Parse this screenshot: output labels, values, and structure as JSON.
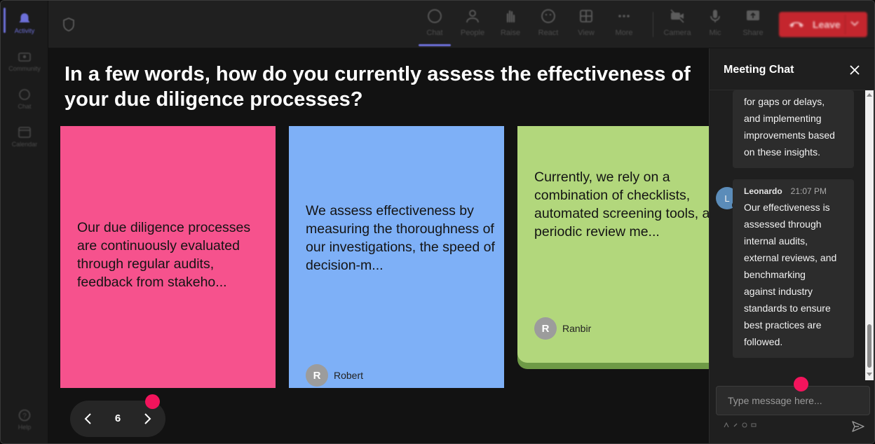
{
  "rail": {
    "items": [
      {
        "label": "Activity",
        "icon": "bell-icon"
      },
      {
        "label": "Community",
        "icon": "community-icon"
      },
      {
        "label": "Chat",
        "icon": "chat-icon"
      },
      {
        "label": "Calendar",
        "icon": "calendar-icon"
      }
    ],
    "help_label": "Help"
  },
  "toolbar": {
    "chat": "Chat",
    "people": "People",
    "raise": "Raise",
    "react": "React",
    "view": "View",
    "more": "More",
    "camera": "Camera",
    "mic": "Mic",
    "share": "Share",
    "leave": "Leave"
  },
  "colors": {
    "accent": "#6c6fd8",
    "leave": "#c4262e",
    "card_pink": "#f6528d",
    "card_blue": "#7eb0f7",
    "card_green": "#b2d77c",
    "marker": "#f2145c"
  },
  "board": {
    "question": "In a few words, how do you currently assess the effectiveness of your due diligence processes?",
    "cards": [
      {
        "text": "Our due diligence processes are continuously evaluated through regular audits, feedback from stakeho...",
        "author": "",
        "initial": ""
      },
      {
        "text": "We assess effectiveness by measuring the thoroughness of our investigations, the speed of decision-m...",
        "author": "Robert",
        "initial": "R"
      },
      {
        "text": "Currently, we rely on a combination of checklists, automated screening tools, and periodic review me...",
        "author": "Ranbir",
        "initial": "R"
      }
    ],
    "page": "6"
  },
  "chat": {
    "title": "Meeting Chat",
    "messages": [
      {
        "lines": [
          "for gaps or delays,",
          "and implementing",
          "improvements based",
          "on these insights."
        ]
      },
      {
        "sender": "Leonardo",
        "time": "21:07 PM",
        "initial": "L",
        "lines": [
          "Our effectiveness is",
          "assessed through",
          "internal audits,",
          "external reviews, and",
          "benchmarking",
          "against industry",
          "standards to ensure",
          "best practices are",
          "followed."
        ]
      }
    ],
    "input_placeholder": "Type message here..."
  }
}
